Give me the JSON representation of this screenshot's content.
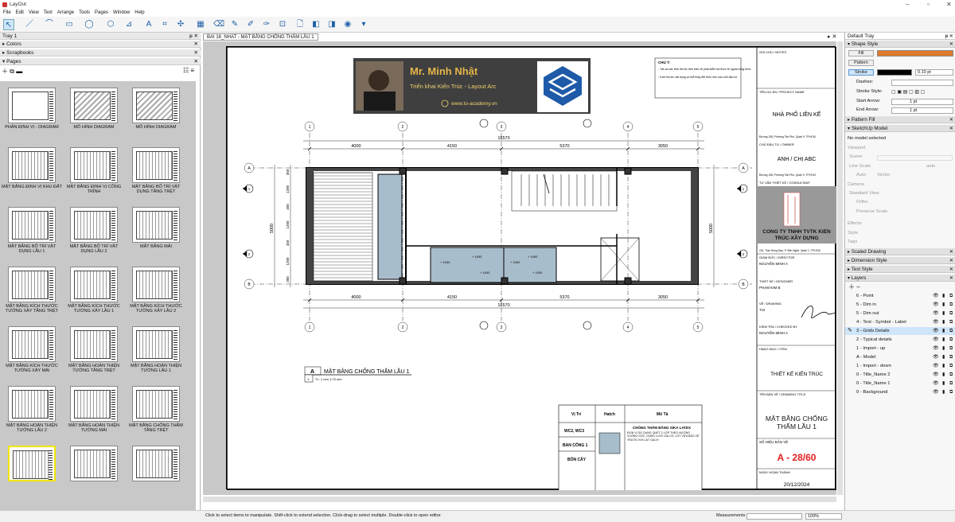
{
  "app": {
    "title": "LayOut"
  },
  "menu": [
    "File",
    "Edit",
    "View",
    "Text",
    "Arrange",
    "Tools",
    "Pages",
    "Window",
    "Help"
  ],
  "left_tray": {
    "title": "Tray 1",
    "panels": [
      "Colors",
      "Scrapbooks",
      "Pages"
    ],
    "pages": [
      {
        "label": "PHÂN ĐỊNH VỊ - DIAGRAM",
        "style": "blank"
      },
      {
        "label": "MÔ HÌNH DIAGRAM",
        "style": "dia"
      },
      {
        "label": "MÔ HÌNH DIAGRAM",
        "style": "dia"
      },
      {
        "label": "MẶT BẰNG ĐỊNH VỊ KHU ĐẤT",
        "style": "plan"
      },
      {
        "label": "MẶT BẰNG ĐỊNH VỊ CÔNG TRÌNH",
        "style": "plan"
      },
      {
        "label": "MẶT BẰNG BỐ TRÍ VẬT DỤNG TẦNG TRỆT",
        "style": "plan"
      },
      {
        "label": "MẶT BẰNG BỐ TRÍ VẬT DỤNG LẦU 1",
        "style": "plan"
      },
      {
        "label": "MẶT BẰNG BỐ TRÍ VẬT DỤNG LẦU 2",
        "style": "plan"
      },
      {
        "label": "MẶT BẰNG MÁI",
        "style": "plan"
      },
      {
        "label": "MẶT BẰNG KÍCH THƯỚC TƯỜNG XÂY TẦNG TRỆT",
        "style": "plan"
      },
      {
        "label": "MẶT BẰNG KÍCH THƯỚC TƯỜNG XÂY LẦU 1",
        "style": "plan"
      },
      {
        "label": "MẶT BẰNG KÍCH THƯỚC TƯỜNG XÂY LẦU 2",
        "style": "plan"
      },
      {
        "label": "MẶT BẰNG KÍCH THƯỚC TƯỜNG XÂY MÁI",
        "style": "plan"
      },
      {
        "label": "MẶT BẰNG HOÀN THIỆN TƯỜNG TẦNG TRỆT",
        "style": "plan"
      },
      {
        "label": "MẶT BẰNG HOÀN THIỆN TƯỜNG LẦU 1",
        "style": "plan"
      },
      {
        "label": "MẶT BẰNG HOÀN THIỆN TƯỜNG LẦU 2",
        "style": "plan"
      },
      {
        "label": "MẶT BẰNG HOÀN THIỆN TƯỜNG MÁI",
        "style": "plan"
      },
      {
        "label": "MẶT BẰNG CHỐNG THẤM TẦNG TRỆT",
        "style": "plan"
      },
      {
        "label": "",
        "style": "plan",
        "selected": true
      },
      {
        "label": "",
        "style": "plan"
      },
      {
        "label": "",
        "style": "plan"
      }
    ]
  },
  "document": {
    "tab": "BAI 16_NHAT - MẶT BẰNG CHỐNG THẤM LẦU 1",
    "banner": {
      "name": "Mr. Minh Nhật",
      "subtitle": "Triển khai Kiến Trúc - Layout Arc",
      "site": "www.to-academy.vn"
    },
    "notes_title": "CHÚ Ý:",
    "notes": [
      "- Tất cả các kích thước trên bản vẽ phải kiểm tra thực tế ngoài công trình.",
      "- Kích thước vật dụng có thể thay đổi theo nhu cầu chủ đầu tư."
    ],
    "plan": {
      "top_dims": [
        "4000",
        "4150",
        "5370",
        "3050"
      ],
      "total_dim": "16570",
      "side_dim": "5000",
      "left_dims": [
        "350",
        "1200",
        "400",
        "1200",
        "450",
        "1200",
        "300"
      ],
      "grid_cols": [
        "1",
        "2",
        "3",
        "4",
        "5"
      ],
      "grid_rows": [
        "A",
        "B"
      ],
      "sections": [
        "1",
        "2"
      ],
      "rooms": [
        "+ 1000",
        "+ 1000",
        "+ 1000",
        "+ 1000",
        "+ 1000",
        "+ 1000"
      ]
    },
    "drawing_label": {
      "code": "A",
      "title": "MẶT BẰNG CHỐNG THẤM LẦU 1",
      "scale": "TL: 1 mm 1:75 mm"
    },
    "legend": {
      "headers": [
        "Vị Trí",
        "Hatch",
        "Mô Tả"
      ],
      "locations": [
        "WC2, WC3",
        "BAN CÔNG 1",
        "BỒN CÂY"
      ],
      "desc_title": "CHỐNG THẤM BẰNG SIKA LATEX",
      "desc": "ĐƠN VỊ SỬ DỤNG QUÉT 2 LỚP THEO HƯỚNG VUÔNG GÓC, DÙNG LƯỚI GIA CỐ, LÓT VỮA BẢO VỆ TRƯỚC KHI LÁT GẠCH"
    },
    "titleblock": {
      "notes_label": "GHI CHÚ / NOTES",
      "project_label": "TÊN DỰ ÁN / PROJECT NAME",
      "project": "NHÀ PHỐ LIÊN KẾ",
      "project_addr": "Đường 138, Phường Tân Phú, Quận 9, TP.HCM",
      "owner_label": "CHỦ ĐẦU TƯ / OWNER",
      "owner": "ANH / CHỊ ABC",
      "owner_addr": "Đường 138, Phường Tân Phú, Quận 9, TP.HCM",
      "consultant_label": "TƯ VẤN THIẾT KẾ / CONSULTANT",
      "company": "CÔNG TY TNHH TVTK KIẾN TRÚC-XÂY DỰNG",
      "company_addr": "201, Trần Hưng Đạo, P. Bến Nghé, Quận 1, TP.HCM",
      "director_label": "GIÁM ĐỐC / DIRECTOR",
      "director": "NGUYỄN MINH A",
      "designer_label": "THIẾT KẾ / DESIGNER",
      "designer": "PHẠM KIM B",
      "drawing_label": "VẼ / DRAWING",
      "drawer": "TUI",
      "checked_label": "KIỂM TRA / CHECKED BY",
      "checker": "NGUYỄN MINH A",
      "item_label": "HẠNG MỤC / ITEM",
      "item": "THIẾT KẾ KIẾN TRÚC",
      "title_label": "TÊN BẢN VẼ / DRAWING TITLE",
      "title": "MẶT BẰNG CHỐNG THẤM LẦU 1",
      "no_label": "SỐ HIỆU BẢN VẼ",
      "number": "A - 28/60",
      "date_label": "NGÀY HOÀN THÀNH",
      "date": "20/12/2024"
    }
  },
  "right_tray": {
    "title": "Default Tray",
    "shape_style": {
      "title": "Shape Style",
      "fill": "Fill",
      "pattern": "Pattern",
      "stroke": "Stroke",
      "stroke_width": "0.10 pt",
      "dashes": "Dashes:",
      "stroke_style": "Stroke Style:",
      "start_arrow": "Start Arrow:",
      "end_arrow": "End Arrow:",
      "arrow_size": "1 pt",
      "fill_color": "#e07a2a",
      "stroke_color": "#000000"
    },
    "pattern_fill": "Pattern Fill",
    "sketchup_model": {
      "title": "SketchUp Model",
      "none": "No model selected",
      "viewport": "Viewport",
      "scene": "Scene",
      "line_scale": "Line Scale",
      "auto": "Auto",
      "vector": "Vector",
      "auto2": "auto",
      "camera": "Camera",
      "standard_view": "Standard View",
      "ortho": "Ortho",
      "preserve_scale": "Preserve Scale",
      "effects": "Effects",
      "style": "Style",
      "tags": "Tags"
    },
    "collapsed": [
      "Scaled Drawing",
      "Dimension Style",
      "Text Style"
    ],
    "layers_title": "Layers",
    "layers": [
      {
        "name": "6 - Point"
      },
      {
        "name": "5 - Dim in"
      },
      {
        "name": "5 - Dim out"
      },
      {
        "name": "4 - Text - Symbol - Label"
      },
      {
        "name": "3 - Grids Details",
        "selected": true
      },
      {
        "name": "2 - Typical details"
      },
      {
        "name": "1 - Import - up"
      },
      {
        "name": "A - Model"
      },
      {
        "name": "1 - Import - down"
      },
      {
        "name": "0 - Title_Name 2"
      },
      {
        "name": "0 - Title_Name 1"
      },
      {
        "name": "0 - Background"
      }
    ]
  },
  "status": {
    "hint": "Click to select items to manipulate. Shift-click to extend selection. Click-drag to select multiple. Double-click to open editor.",
    "measurements_label": "Measurements",
    "zoom": "109%"
  }
}
